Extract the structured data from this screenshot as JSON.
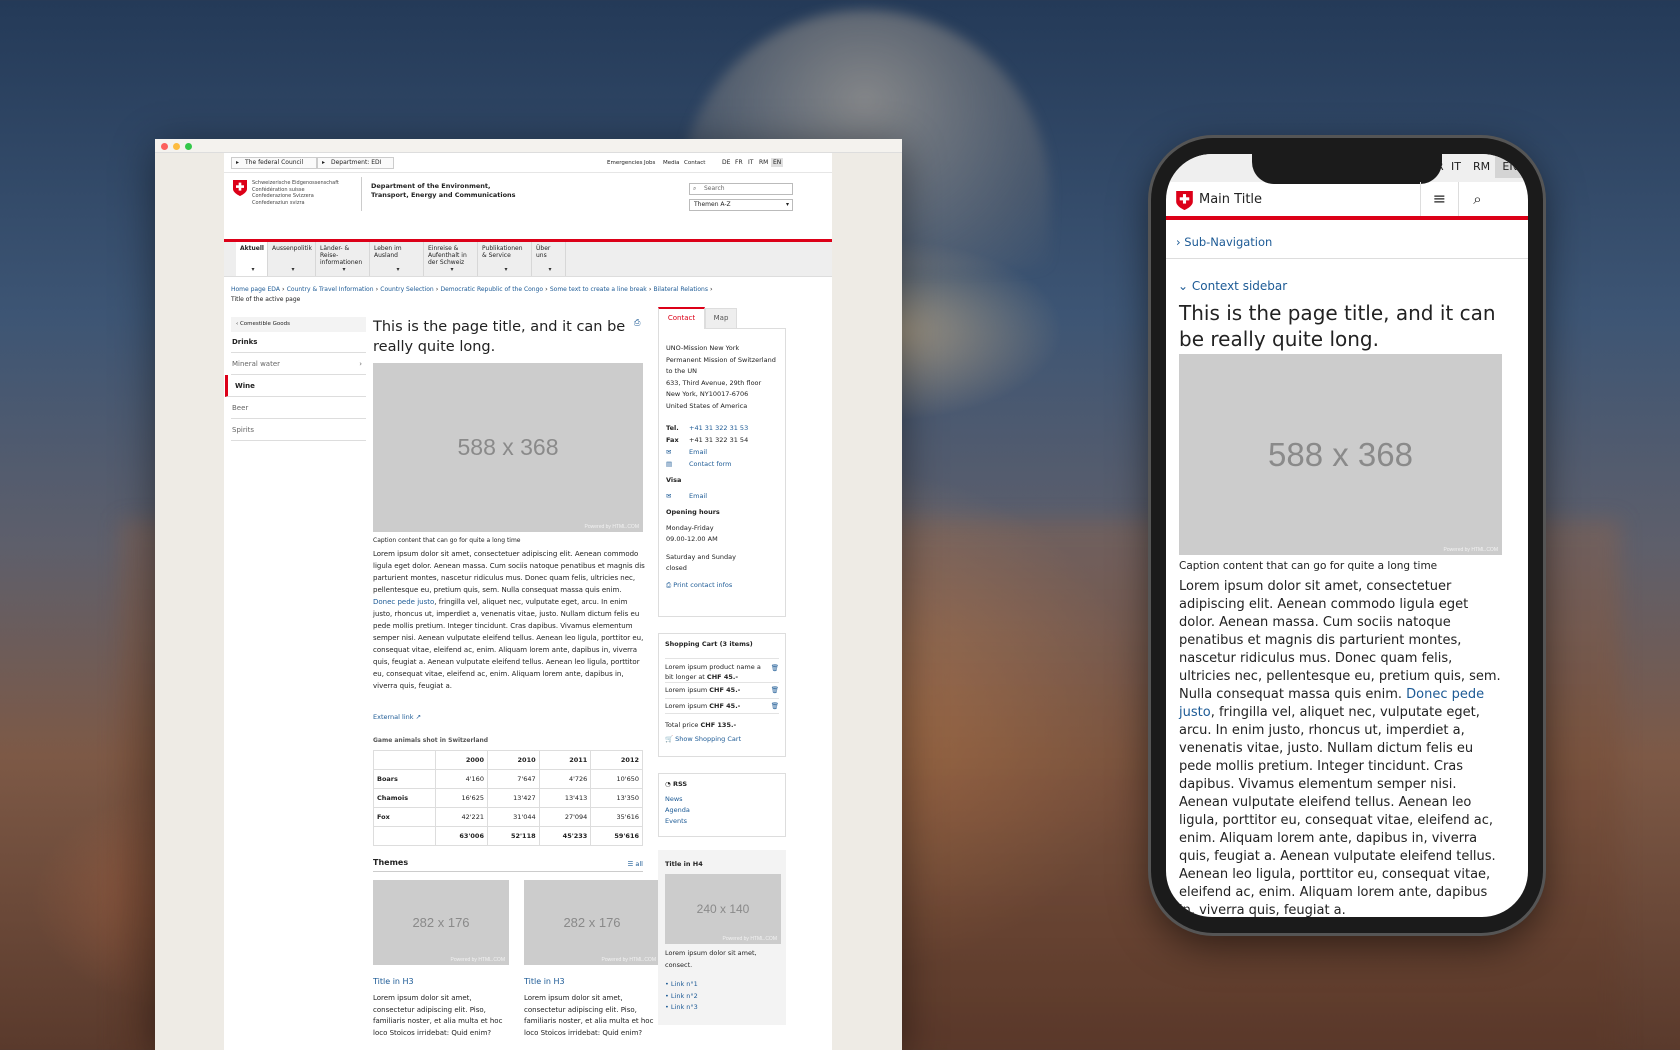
{
  "desktop": {
    "topbar": {
      "crumb1": "The federal Council",
      "crumb2": "Department: EDI",
      "links": [
        "Emergencies",
        "Jobs",
        "Media",
        "Contact"
      ],
      "langs": [
        "DE",
        "FR",
        "IT",
        "RM",
        "EN"
      ]
    },
    "logo_lines": [
      "Schweizerische Eidgenossenschaft",
      "Confédération suisse",
      "Confederazione Svizzera",
      "Confederaziun svizra"
    ],
    "dept": [
      "Department of the Environment,",
      "Transport, Energy and Communications"
    ],
    "search_placeholder": "Search",
    "themen": "Themen A-Z",
    "nav": [
      [
        "Aktuell"
      ],
      [
        "Aussenpolitik"
      ],
      [
        "Länder- &",
        "Reise-",
        "informationen"
      ],
      [
        "Leben im",
        "Ausland"
      ],
      [
        "Einreise &",
        "Aufenthalt in",
        "der Schweiz"
      ],
      [
        "Publikationen",
        "& Service"
      ],
      [
        "Über uns"
      ]
    ],
    "breadcrumb": [
      "Home page EDA",
      "Country & Travel Information",
      "Country Selection",
      "Democratic Republic of the Congo",
      "Some text to create a line break",
      "Bilateral Relations"
    ],
    "breadcrumb_active": "Title of the active page",
    "sidebar": {
      "back": "Comestible Goods",
      "title": "Drinks",
      "items": [
        "Mineral water",
        "Wine",
        "Beer",
        "Spirits"
      ]
    },
    "title": [
      "This is the page title, and it can be",
      "really quite long."
    ],
    "image_label": "588 x 368",
    "powered": "Powered by HTML.COM",
    "caption": "Caption content that can go for quite a long time",
    "body_a": "Lorem ipsum dolor sit amet, consectetuer adipiscing elit. Aenean commodo ligula eget dolor. Aenean massa. Cum sociis natoque penatibus et magnis dis parturient montes, nascetur ridiculus mus. Donec quam felis, ultricies nec, pellentesque eu, pretium quis, sem. Nulla consequat massa quis enim.",
    "body_link": "Donec pede justo",
    "body_b": ", fringilla vel, aliquet nec, vulputate eget, arcu. In enim justo, rhoncus ut, imperdiet a, venenatis vitae, justo. Nullam dictum felis eu pede mollis pretium. Integer tincidunt. Cras dapibus. Vivamus elementum semper nisi. Aenean vulputate eleifend tellus. Aenean leo ligula, porttitor eu, consequat vitae, eleifend ac, enim. Aliquam lorem ante, dapibus in, viverra quis, feugiat a. Aenean vulputate eleifend tellus. Aenean leo ligula, porttitor eu, consequat vitae, eleifend ac, enim. Aliquam lorem ante, dapibus in, viverra quis, feugiat a.",
    "external_link": "External link",
    "table_caption": "Game animals shot in Switzerland",
    "table": [
      [
        "",
        "2000",
        "2010",
        "2011",
        "2012"
      ],
      [
        "Boars",
        "4'160",
        "7'647",
        "4'726",
        "10'650"
      ],
      [
        "Chamois",
        "16'625",
        "13'427",
        "13'413",
        "13'350"
      ],
      [
        "Fox",
        "42'221",
        "31'044",
        "27'094",
        "35'616"
      ],
      [
        "",
        "63'006",
        "52'118",
        "45'233",
        "59'616"
      ]
    ],
    "themes": {
      "title": "Themes",
      "all": "all",
      "image": "282 x 176",
      "cards": [
        {
          "title": "Title in H3",
          "text": [
            "Lorem ipsum dolor sit amet,",
            "consectetur adipiscing elit. Piso,",
            "familiaris noster, et alia multa et hoc",
            "loco Stoicos irridebat: Quid enim?"
          ]
        },
        {
          "title": "Title in H3",
          "text": [
            "Lorem ipsum dolor sit amet,",
            "consectetur adipiscing elit. Piso,",
            "familiaris noster, et alia multa et hoc",
            "loco Stoicos irridebat: Quid enim?"
          ]
        }
      ]
    },
    "contact": {
      "tabs": [
        "Contact",
        "Map"
      ],
      "address": [
        "UNO-Mission New York",
        "Permanent Mission of Switzerland",
        "to the UN",
        "633, Third Avenue, 29th floor",
        "New York, NY10017-6706",
        "United States of America"
      ],
      "tel_label": "Tel.",
      "tel": "+41 31 322 31 53",
      "fax_label": "Fax",
      "fax": "+41 31 322 31 54",
      "email": "Email",
      "form": "Contact form",
      "visa": "Visa",
      "visa_email": "Email",
      "hours_title": "Opening hours",
      "hours": [
        "Monday-Friday",
        "09.00-12.00 AM",
        "Saturday and Sunday",
        "closed"
      ],
      "print": "Print contact infos"
    },
    "cart": {
      "title": "Shopping Cart (3 items)",
      "items": [
        [
          "Lorem ipsum product name a",
          "bit longer at ",
          "CHF 45.-"
        ],
        [
          "Lorem ipsum ",
          "CHF 45.-"
        ],
        [
          "Lorem ipsum ",
          "CHF 45.-"
        ]
      ],
      "total_label": "Total price ",
      "total": "CHF 135.-",
      "show": "Show Shopping Cart"
    },
    "rss": {
      "title": "RSS",
      "links": [
        "News",
        "Agenda",
        "Events"
      ]
    },
    "h4box": {
      "title": "Title in H4",
      "image": "240 x 140",
      "text": [
        "Lorem ipsum dolor sit amet,",
        "consect."
      ],
      "links": [
        "Link n°1",
        "Link n°2",
        "Link n°3"
      ]
    }
  },
  "mobile": {
    "langs": [
      "R",
      "IT",
      "RM",
      "EN"
    ],
    "main_title": "Main Title",
    "subnav": "Sub-Navigation",
    "context": "Context sidebar",
    "title": [
      "This is the page title, and it can",
      "be really quite long."
    ],
    "image_label": "588 x 368",
    "powered": "Powered by HTML.COM",
    "caption": "Caption content that can go for quite a long time",
    "body_a": "Lorem ipsum dolor sit amet, consectetuer adipiscing elit. Aenean commodo ligula eget dolor. Aenean massa. Cum sociis natoque penatibus et magnis dis parturient montes, nascetur ridiculus mus. Donec quam felis, ultricies nec, pellentesque eu, pretium quis, sem. Nulla consequat massa quis enim.",
    "body_link": "Donec pede justo",
    "body_b": ", fringilla vel, aliquet nec, vulputate eget, arcu. In enim justo, rhoncus ut, imperdiet a, venenatis vitae, justo. Nullam dictum felis eu pede mollis pretium. Integer tincidunt. Cras dapibus. Vivamus elementum semper nisi. Aenean vulputate eleifend tellus. Aenean leo ligula, porttitor eu, consequat vitae, eleifend ac, enim. Aliquam lorem ante, dapibus in, viverra quis, feugiat a. Aenean vulputate eleifend tellus. Aenean leo ligula, porttitor eu, consequat vitae, eleifend ac, enim. Aliquam lorem ante, dapibus in, viverra quis, feugiat a."
  },
  "colors": {
    "swiss_red": "#dc0018",
    "link_blue": "#1c5a95"
  }
}
